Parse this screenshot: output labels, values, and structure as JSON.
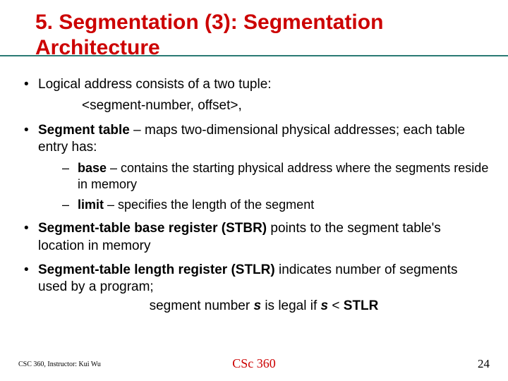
{
  "title": "5. Segmentation (3): Segmentation Architecture",
  "bullets": {
    "b1_text": "Logical address consists of a two tuple:",
    "b1_sub": "<segment-number, offset>,",
    "b2_lead": "Segment table",
    "b2_rest": " – maps two-dimensional physical addresses; each table entry has:",
    "b2_s1_lead": "base",
    "b2_s1_rest": " – contains the starting physical address where the segments reside in memory",
    "b2_s2_lead": "limit",
    "b2_s2_rest": " – specifies the length of the segment",
    "b3_lead": "Segment-table base register (STBR)",
    "b3_rest": " points to the segment table's location in memory",
    "b4_lead": "Segment-table length register (STLR)",
    "b4_rest": " indicates number of segments used by a program;",
    "b4_line2_a": "segment number ",
    "b4_line2_s1": "s",
    "b4_line2_b": " is legal if ",
    "b4_line2_s2": "s",
    "b4_line2_c": " < ",
    "b4_line2_d": "STLR"
  },
  "footer": {
    "left": "CSC 360, Instructor: Kui Wu",
    "center": "CSc 360",
    "right": "24"
  }
}
